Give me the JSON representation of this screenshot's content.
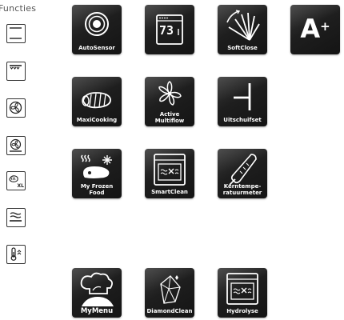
{
  "section": {
    "title": "Functies"
  },
  "side_icons": [
    {
      "icon": "top-bottom-heat-icon"
    },
    {
      "icon": "grill-icon"
    },
    {
      "icon": "fan-icon"
    },
    {
      "icon": "fan-with-heat-icon"
    },
    {
      "icon": "xl-grill-icon"
    },
    {
      "icon": "steam-heat-icon"
    },
    {
      "icon": "thermometer-icon"
    }
  ],
  "tiles": {
    "autosensor": {
      "label": "AutoSensor"
    },
    "timer": {
      "display": "73"
    },
    "softclose": {
      "label": "SoftClose"
    },
    "energy": {
      "letter": "A",
      "sup": "+"
    },
    "maxicooking": {
      "label": "MaxiCooking"
    },
    "multiflow": {
      "line1": "Active",
      "line2": "Multiflow"
    },
    "uitschuifset": {
      "label": "Uitschuifset"
    },
    "frozen": {
      "line1": "My Frozen",
      "line2": "Food"
    },
    "smartclean": {
      "label": "SmartClean"
    },
    "kerntemp": {
      "line1": "Kerntempe-",
      "line2": "ratuurmeter"
    },
    "mymenu": {
      "label": "MyMenu"
    },
    "diamondclean": {
      "label": "DiamondClean"
    },
    "hydrolyse": {
      "label": "Hydrolyse"
    }
  }
}
